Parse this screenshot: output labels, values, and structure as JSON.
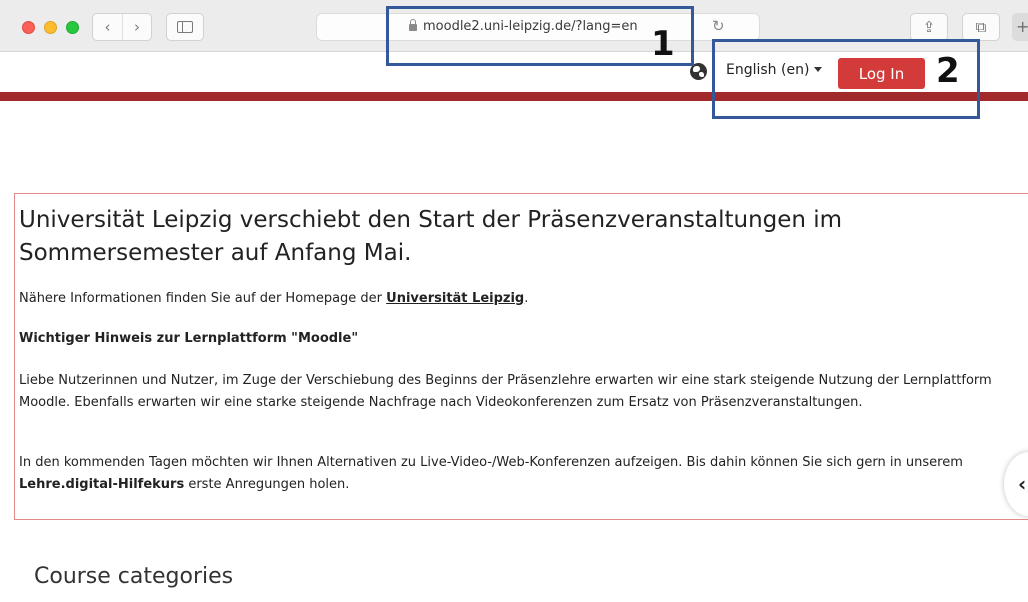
{
  "browser": {
    "url": "moodle2.uni-leipzig.de/?lang=en",
    "back_glyph": "‹",
    "forward_glyph": "›",
    "reload_glyph": "↻",
    "share_glyph": "⇪",
    "tabs_glyph": "⧉",
    "newtab_glyph": "+"
  },
  "annotations": {
    "box1_label": "1",
    "box2_label": "2"
  },
  "header": {
    "language": "English ‎(en)‎",
    "login_label": "Log In"
  },
  "notice": {
    "title": "Universität Leipzig verschiebt den Start der Präsenzveranstaltungen im Sommersemester auf Anfang Mai.",
    "p1_prefix": "Nähere Informationen finden Sie auf der Homepage der ",
    "p1_link": "Universität Leipzig",
    "p1_suffix": ".",
    "heading": "Wichtiger Hinweis zur Lernplattform \"Moodle\"",
    "p3": "Liebe Nutzerinnen und Nutzer, im Zuge der Verschiebung des Beginns der Präsenzlehre erwarten wir eine stark steigende Nutzung der Lernplattform Moodle. Ebenfalls erwarten wir eine starke steigende Nachfrage nach Videokonferenzen zum Ersatz von Präsenzveranstaltungen.",
    "p4_prefix": "In den kommenden Tagen möchten wir Ihnen Alternativen zu Live-Video-/Web-Konferenzen aufzeigen. Bis dahin können Sie sich gern in unserem ",
    "p4_bold": "Lehre.digital-Hilfekurs",
    "p4_suffix": " erste Anregungen holen."
  },
  "drawer_toggle_glyph": "‹",
  "section": {
    "course_categories": "Course categories"
  },
  "colors": {
    "accent_red": "#d33b3b",
    "brand_bar": "#a22a2a",
    "annotation_blue": "#34589a"
  }
}
